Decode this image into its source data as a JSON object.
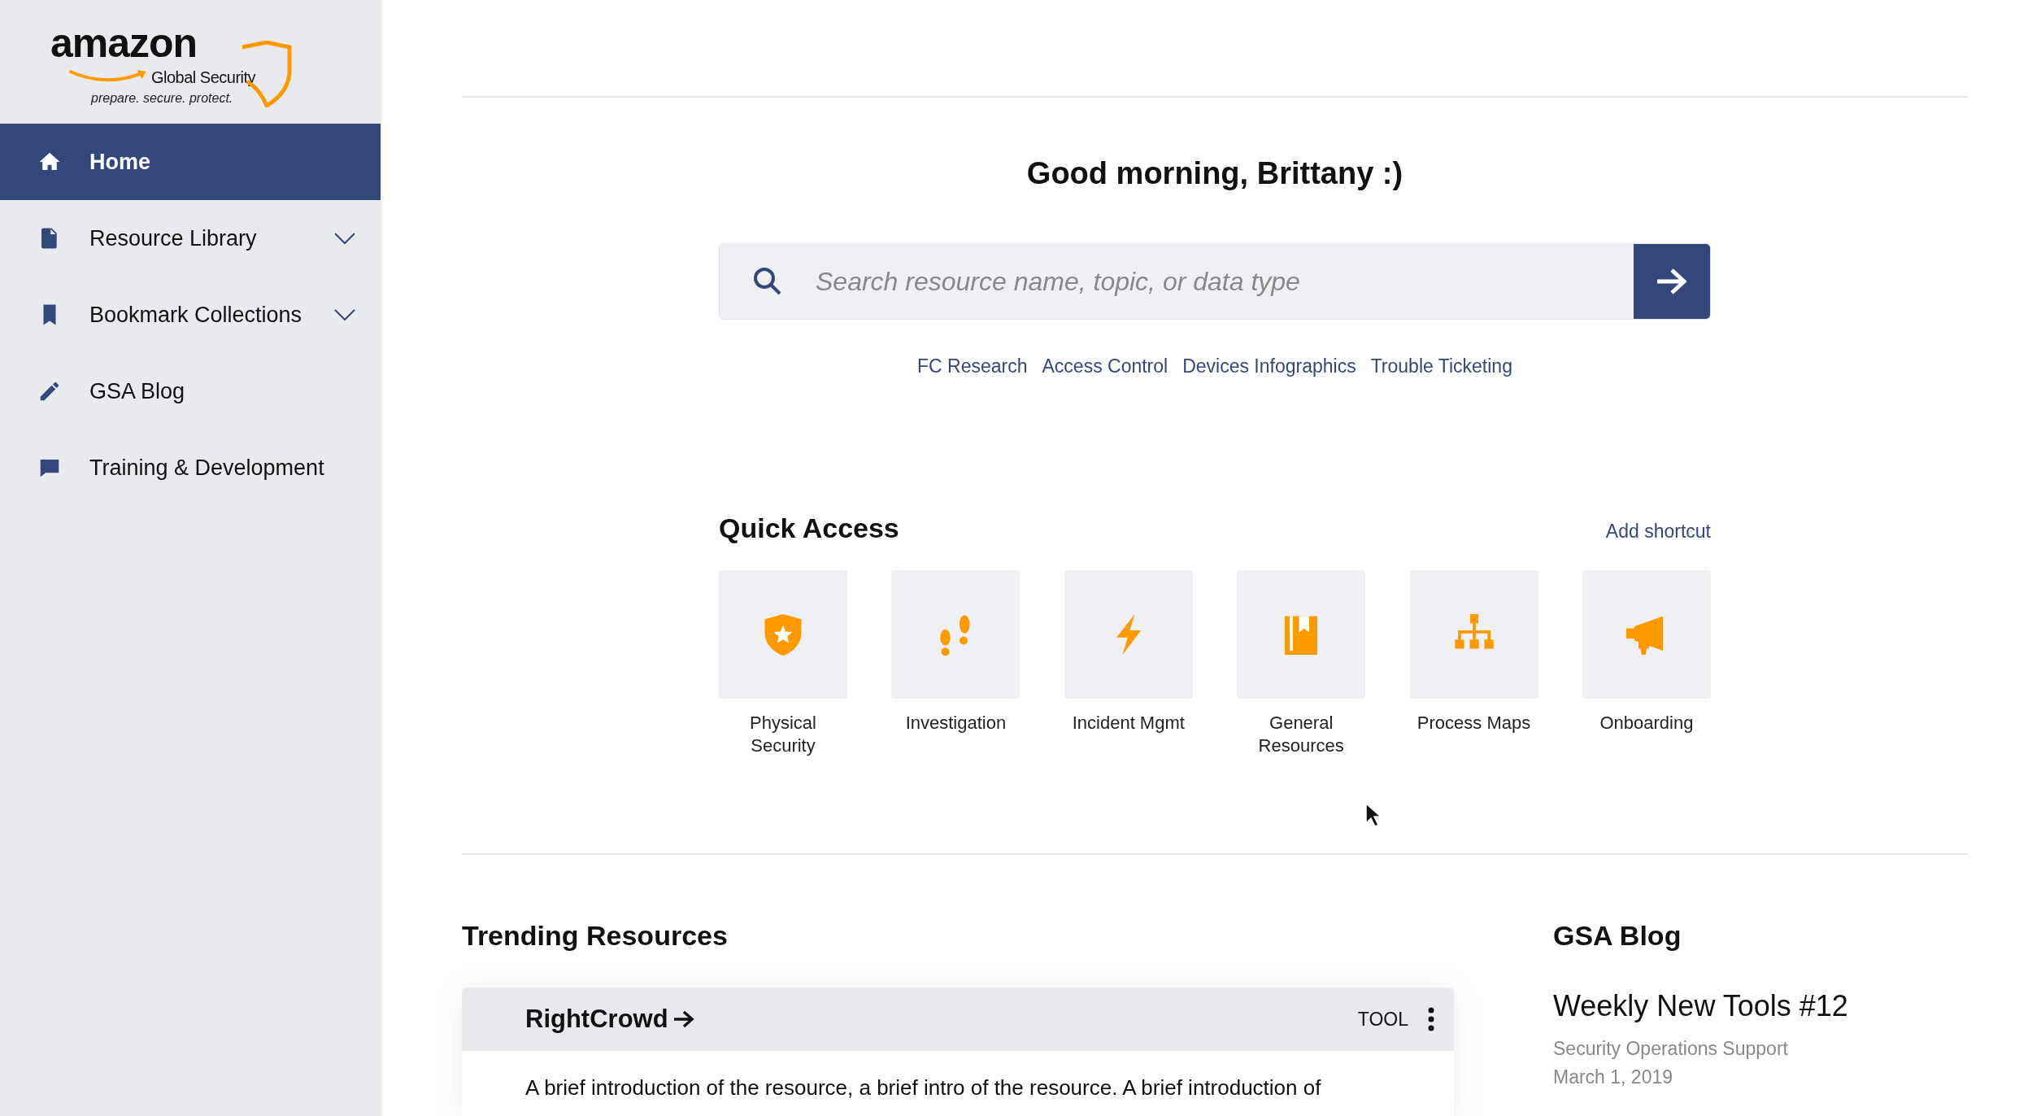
{
  "logo": {
    "wordmark": "amazon",
    "product": "Global Security",
    "tagline": "prepare. secure. protect."
  },
  "sidebar": {
    "items": [
      {
        "label": "Home",
        "kind": "home",
        "selected": true,
        "has_submenu": false
      },
      {
        "label": "Resource Library",
        "kind": "document",
        "selected": false,
        "has_submenu": true
      },
      {
        "label": "Bookmark Collections",
        "kind": "bookmark",
        "selected": false,
        "has_submenu": true
      },
      {
        "label": "GSA Blog",
        "kind": "pencil",
        "selected": false,
        "has_submenu": false
      },
      {
        "label": "Training & Development",
        "kind": "chat",
        "selected": false,
        "has_submenu": false
      }
    ]
  },
  "greeting": "Good morning, Brittany :)",
  "search": {
    "placeholder": "Search resource name, topic, or data type"
  },
  "quick_links": [
    "FC Research",
    "Access Control",
    "Devices Infographics",
    "Trouble Ticketing"
  ],
  "quick_access": {
    "title": "Quick Access",
    "action": "Add shortcut",
    "tiles": [
      {
        "label": "Physical Security",
        "kind": "shield"
      },
      {
        "label": "Investigation",
        "kind": "footprints"
      },
      {
        "label": "Incident Mgmt",
        "kind": "bolt"
      },
      {
        "label": "General Resources",
        "kind": "book"
      },
      {
        "label": "Process Maps",
        "kind": "sitemap"
      },
      {
        "label": "Onboarding",
        "kind": "megaphone"
      }
    ]
  },
  "trending": {
    "title": "Trending Resources",
    "cards": [
      {
        "title": "RightCrowd",
        "type": "TOOL",
        "description": "A brief introduction of the resource, a brief intro of the resource. A brief introduction of"
      }
    ]
  },
  "blog": {
    "title": "GSA Blog",
    "posts": [
      {
        "title": "Weekly New Tools #12",
        "author": "Security Operations Support",
        "date": "March 1, 2019"
      }
    ]
  }
}
